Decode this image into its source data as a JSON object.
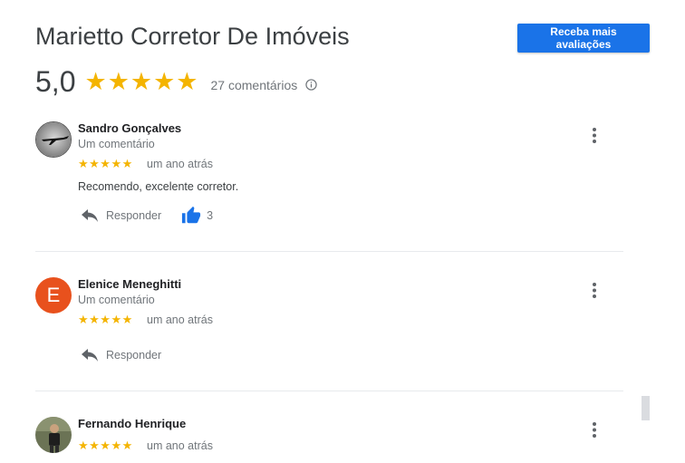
{
  "header": {
    "title": "Marietto Corretor De Imóveis",
    "cta_label": "Receba mais avaliações"
  },
  "summary": {
    "rating": "5,0",
    "stars": "★★★★★",
    "count_label": "27 comentários",
    "info_icon": "info-icon"
  },
  "reviews": [
    {
      "name": "Sandro Gonçalves",
      "subtitle": "Um comentário",
      "stars": "★★★★★",
      "rating": 5,
      "time": "um ano atrás",
      "text": "Recomendo, excelente corretor.",
      "reply_label": "Responder",
      "likes": "3",
      "avatar": "photo-avatar"
    },
    {
      "name": "Elenice Meneghitti",
      "subtitle": "Um comentário",
      "stars": "★★★★★",
      "rating": 5,
      "time": "um ano atrás",
      "reply_label": "Responder",
      "avatar_letter": "E",
      "avatar_color": "#e8511d"
    },
    {
      "name": "Fernando Henrique",
      "stars": "★★★★★",
      "rating": 5,
      "time": "um ano atrás",
      "avatar": "photo-avatar"
    }
  ],
  "colors": {
    "accent": "#1a73e8",
    "star": "#f4b400",
    "muted_text": "#70757a"
  }
}
